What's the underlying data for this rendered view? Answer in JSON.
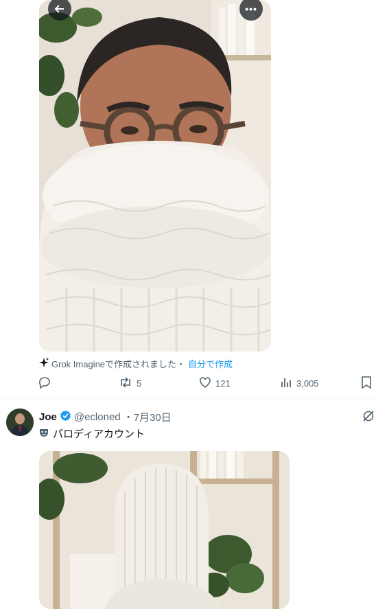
{
  "post1": {
    "grok_text": "Grok Imagineで作成されました・",
    "grok_link": "自分で作成",
    "retweets": "5",
    "likes": "121",
    "views": "3,005"
  },
  "post2": {
    "name": "Joe",
    "handle": "@ecloned",
    "date": "・7月30日",
    "parody_label": "パロディアカウント"
  }
}
